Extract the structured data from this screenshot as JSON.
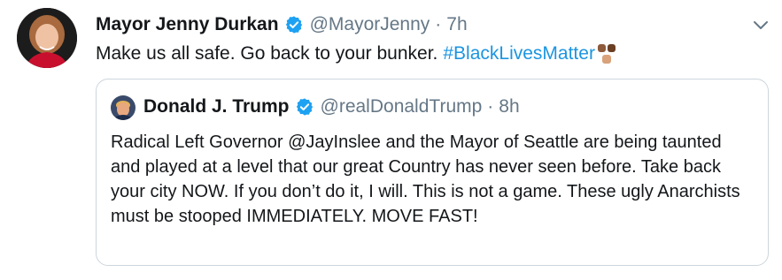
{
  "tweet": {
    "author_name": "Mayor Jenny Durkan",
    "author_handle": "@MayorJenny",
    "separator": "·",
    "time": "7h",
    "text": "Make us all safe. Go back to your bunker.",
    "hashtag": "#BlackLivesMatter"
  },
  "quoted_tweet": {
    "author_name": "Donald J. Trump",
    "author_handle": "@realDonaldTrump",
    "separator": "·",
    "time": "8h",
    "text": "Radical Left Governor @JayInslee and the Mayor of Seattle are being taunted and played at a level that our great Country has never seen before. Take back your city NOW. If you don’t do it, I will. This is not a game. These ugly Anarchists must be stooped IMMEDIATELY. MOVE FAST!"
  },
  "colors": {
    "link": "#1b95e0",
    "verified": "#1da1f2",
    "secondary_text": "#657786",
    "border": "#ccd6dd"
  },
  "icons": {
    "verified": "verified-badge-icon",
    "caret": "chevron-down-icon",
    "emoji": "raised-fists-emoji-icon"
  }
}
